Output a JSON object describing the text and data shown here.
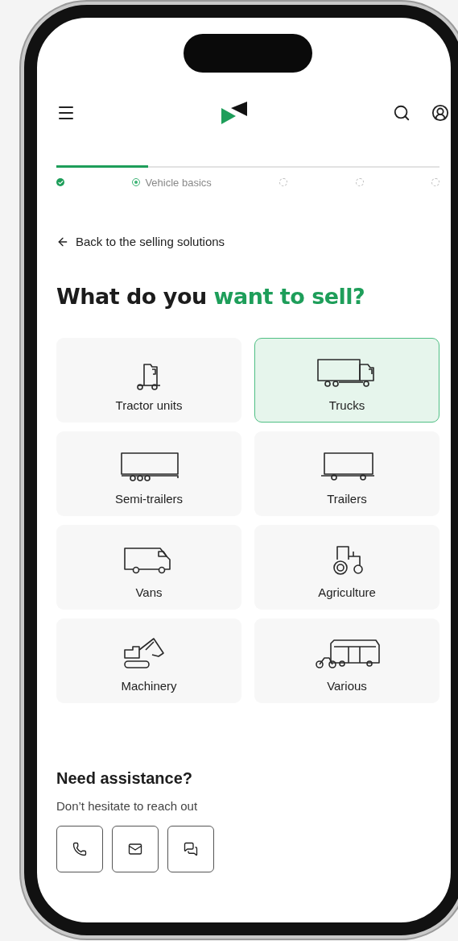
{
  "progress": {
    "level": 0.24,
    "steps": [
      {
        "kind": "done"
      },
      {
        "kind": "current",
        "label": "Vehicle basics"
      },
      {
        "kind": "todo"
      },
      {
        "kind": "todo"
      },
      {
        "kind": "todo"
      }
    ]
  },
  "back_link": "Back to the selling solutions",
  "title": {
    "text": "What do you",
    "highlight": "want to sell?"
  },
  "categories": [
    {
      "label": "Tractor units",
      "kind": "tractor-unit",
      "selected": false
    },
    {
      "label": "Trucks",
      "kind": "truck",
      "selected": true
    },
    {
      "label": "Semi-trailers",
      "kind": "semi-trailer",
      "selected": false
    },
    {
      "label": "Trailers",
      "kind": "trailer",
      "selected": false
    },
    {
      "label": "Vans",
      "kind": "van",
      "selected": false
    },
    {
      "label": "Agriculture",
      "kind": "tractor",
      "selected": false
    },
    {
      "label": "Machinery",
      "kind": "excavator",
      "selected": false
    },
    {
      "label": "Various",
      "kind": "bus",
      "selected": false
    }
  ],
  "assistance": {
    "title": "Need assistance?",
    "subtitle": "Don’t hesitate to reach out",
    "contacts": [
      {
        "kind": "phone"
      },
      {
        "kind": "mail"
      },
      {
        "kind": "chat"
      }
    ]
  }
}
